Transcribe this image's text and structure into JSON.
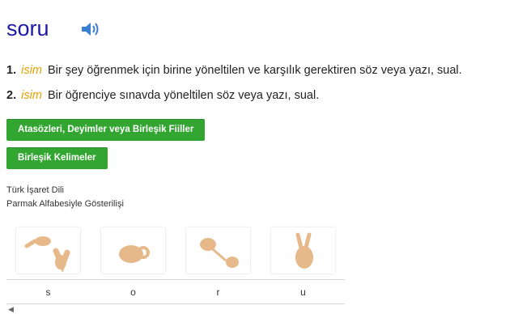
{
  "word": "soru",
  "speaker_icon": "speaker-icon",
  "definitions": [
    {
      "number": "1.",
      "pos": "isim",
      "text": "Bir şey öğrenmek için birine yöneltilen ve karşılık gerektiren söz veya yazı, sual."
    },
    {
      "number": "2.",
      "pos": "isim",
      "text": "Bir öğrenciye sınavda yöneltilen söz veya yazı, sual."
    }
  ],
  "buttons": {
    "idioms": "Atasözleri, Deyimler veya Birleşik Fiiller",
    "compounds": "Birleşik Kelimeler"
  },
  "sign_language": {
    "title": "Türk İşaret Dili",
    "subtitle": "Parmak Alfabesiyle Gösterilişi",
    "letters": [
      "s",
      "o",
      "r",
      "u"
    ]
  },
  "colors": {
    "title": "#1a1aa6",
    "pos": "#e8a000",
    "button": "#33a531"
  }
}
